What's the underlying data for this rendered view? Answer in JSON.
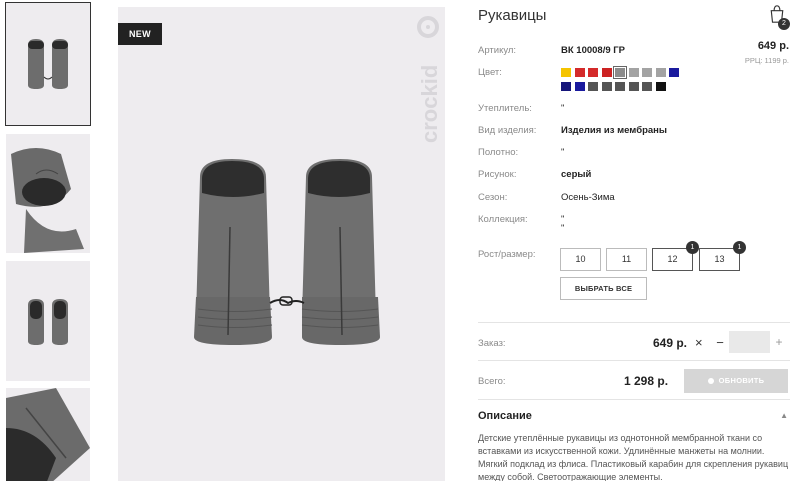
{
  "gallery": {
    "new_badge": "NEW",
    "brand": "crockid"
  },
  "product": {
    "title": "Рукавицы",
    "cart_count": "2",
    "price": "649 р.",
    "rrc_price": "РРЦ: 1199 р.",
    "attributes": [
      {
        "label": "Артикул:",
        "value": "ВК 10008/9 ГР"
      },
      {
        "label": "Цвет:",
        "value": ""
      },
      {
        "label": "Утеплитель:",
        "value": "\""
      },
      {
        "label": "Вид изделия:",
        "value": "Изделия из мембраны"
      },
      {
        "label": "Полотно:",
        "value": "\""
      },
      {
        "label": "Рисунок:",
        "value": "серый"
      },
      {
        "label": "Сезон:",
        "value": "Осень-Зима"
      },
      {
        "label": "Коллекция:",
        "value": "\""
      },
      {
        "label": "Рост/размер:",
        "value": ""
      }
    ],
    "collection_extra": "\"",
    "colors_row1": [
      "#f5c400",
      "#d42a2a",
      "#d42a2a",
      "#cc2222",
      "#8c8c8c",
      "#a3a3a3",
      "#a3a3a3",
      "#a3a3a3",
      "#1a1a9e"
    ],
    "colors_row2": [
      "#15157a",
      "#1a1a9e",
      "#555555",
      "#555555",
      "#555555",
      "#555555",
      "#555555",
      "#111111"
    ],
    "selected_color_index": 4,
    "sizes": [
      {
        "label": "10",
        "count": ""
      },
      {
        "label": "11",
        "count": ""
      },
      {
        "label": "12",
        "count": "1"
      },
      {
        "label": "13",
        "count": "1"
      }
    ],
    "select_all_label": "ВЫБРАТЬ ВСЕ"
  },
  "order": {
    "label": "Заказ:",
    "price": "649 р.",
    "times": "×",
    "minus": "−",
    "qty": "",
    "plus": "+"
  },
  "total": {
    "label": "Всего:",
    "value": "1 298 р.",
    "update_label": "ОБНОВИТЬ"
  },
  "description": {
    "title": "Описание",
    "caret": "▲",
    "text": "Детские утеплённые рукавицы из однотонной мембранной ткани со вставками из искусственной кожи. Удлинённые манжеты на молнии. Мягкий подклад из флиса. Пластиковый карабин для скрепления рукавиц между собой. Светоотражающие элементы."
  }
}
